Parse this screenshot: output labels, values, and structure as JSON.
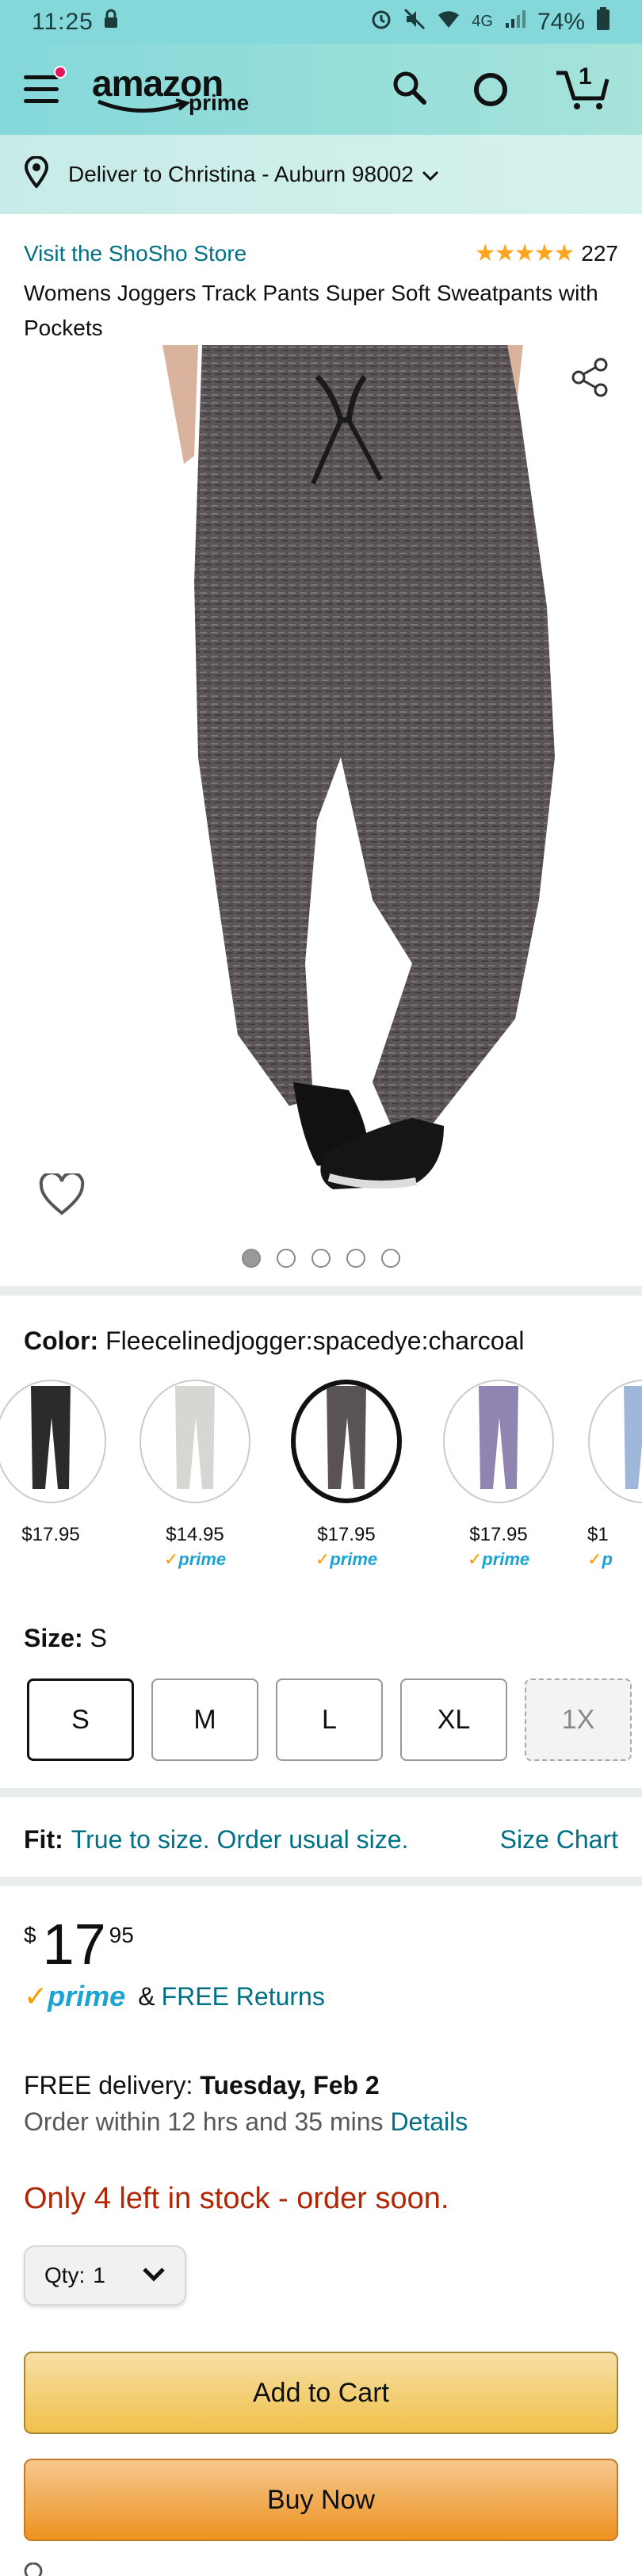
{
  "status_bar": {
    "time": "11:25",
    "network": "4G",
    "battery": "74%"
  },
  "header": {
    "logo_text": "amazon",
    "logo_sub": "prime",
    "cart_count": "1"
  },
  "delivery_bar": {
    "text": "Deliver to Christina - Auburn 98002"
  },
  "product": {
    "store_link": "Visit the ShoSho Store",
    "rating_stars": "★★★★★",
    "rating_value": 4.5,
    "rating_count": "227",
    "title": "Womens Joggers Track Pants Super Soft Sweatpants with Pockets"
  },
  "carousel": {
    "image_count": 5,
    "active_index": 0
  },
  "color": {
    "label": "Color:",
    "value": "Fleecelinedjogger:spacedye:charcoal",
    "swatches": [
      {
        "price": "$17.95",
        "prime": "",
        "shade": "#2b2b2b"
      },
      {
        "price": "$14.95",
        "prime": "prime",
        "shade": "#d6d6d3"
      },
      {
        "price": "$17.95",
        "prime": "prime",
        "shade": "#5a5355",
        "selected": true
      },
      {
        "price": "$17.95",
        "prime": "prime",
        "shade": "#8f85b0"
      },
      {
        "price": "$1",
        "prime": "p",
        "shade": "#9fb7d9"
      }
    ]
  },
  "size": {
    "label": "Size:",
    "value": "S",
    "options": [
      "S",
      "M",
      "L",
      "XL",
      "1X"
    ]
  },
  "fit": {
    "label": "Fit:",
    "text": "True to size. Order usual size.",
    "chart_link": "Size Chart"
  },
  "price": {
    "currency": "$",
    "whole": "17",
    "fraction": "95"
  },
  "prime_row": {
    "prime": "prime",
    "amp": "&",
    "returns": "FREE Returns"
  },
  "delivery": {
    "prefix": "FREE delivery:",
    "date": "Tuesday, Feb 2",
    "order_within": "Order within 12 hrs and 35 mins",
    "details_link": "Details"
  },
  "stock": {
    "text": "Only 4 left in stock - order soon."
  },
  "quantity": {
    "label": "Qty:",
    "value": "1"
  },
  "buttons": {
    "add_to_cart": "Add to Cart",
    "buy_now": "Buy Now"
  },
  "colors": {
    "teal_link": "#007185",
    "price_red": "#b12704",
    "header_teal": "#84d8da",
    "add_to_cart_yellow": "#f0c14b",
    "buy_now_orange": "#ed9220"
  }
}
